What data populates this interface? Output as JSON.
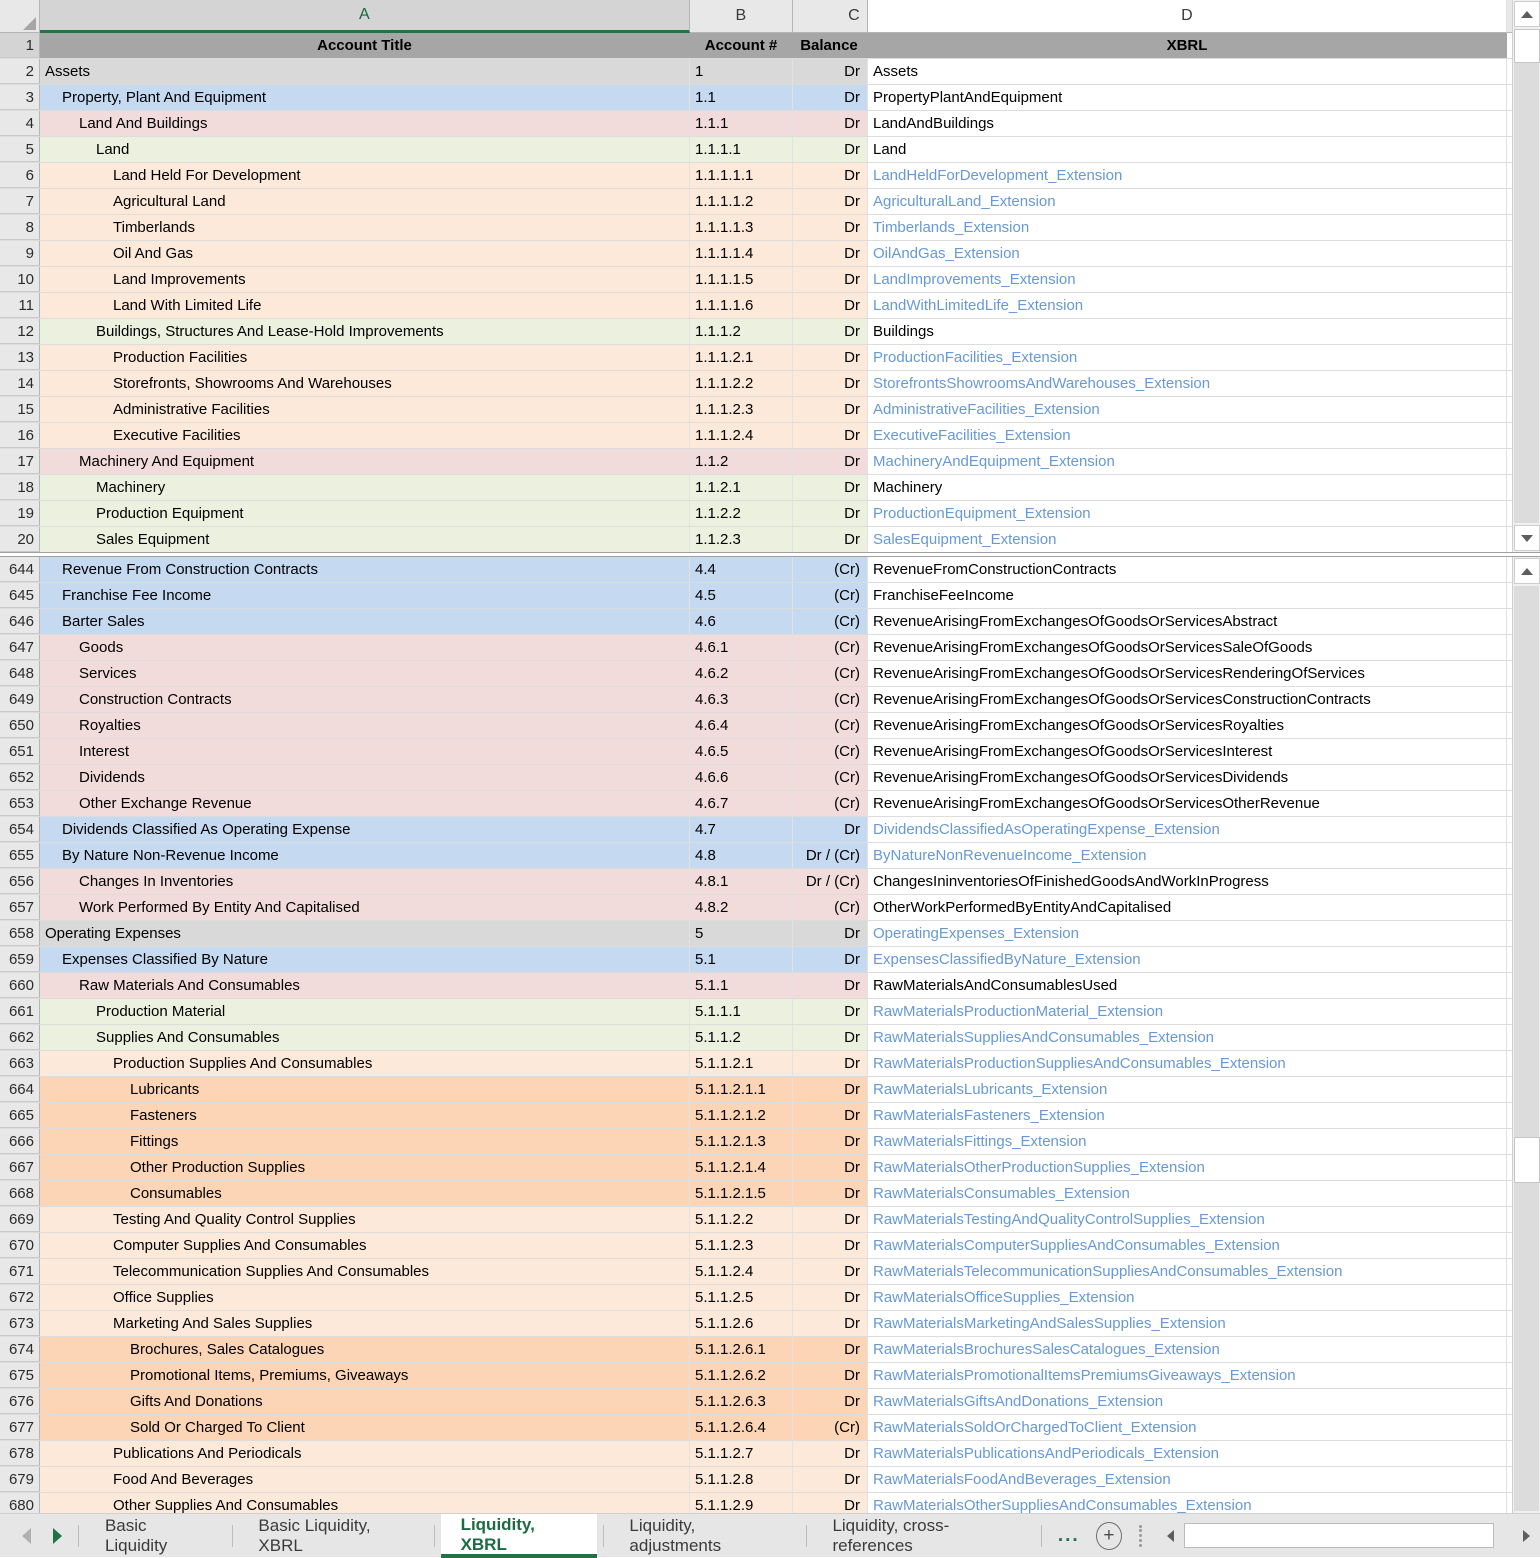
{
  "columns": {
    "headers": [
      {
        "letter": "A",
        "selected": true
      },
      {
        "letter": "B",
        "selected": false
      },
      {
        "letter": "C",
        "selected": false
      },
      {
        "letter": "D",
        "selected": false
      }
    ]
  },
  "header_row": {
    "num": "1",
    "a": "Account Title",
    "b": "Account #",
    "c": "Balance",
    "d": "XBRL"
  },
  "pane_top": [
    {
      "num": "2",
      "title": "Assets",
      "indent": 0,
      "acct": "1",
      "bal": "Dr",
      "xbrl": "Assets",
      "ext": false,
      "fill": "f-grey"
    },
    {
      "num": "3",
      "title": "Property, Plant And Equipment",
      "indent": 1,
      "acct": "1.1",
      "bal": "Dr",
      "xbrl": "PropertyPlantAndEquipment",
      "ext": false,
      "fill": "f-blue"
    },
    {
      "num": "4",
      "title": "Land And Buildings",
      "indent": 2,
      "acct": "1.1.1",
      "bal": "Dr",
      "xbrl": "LandAndBuildings",
      "ext": false,
      "fill": "f-pink"
    },
    {
      "num": "5",
      "title": "Land",
      "indent": 3,
      "acct": "1.1.1.1",
      "bal": "Dr",
      "xbrl": "Land",
      "ext": false,
      "fill": "f-green"
    },
    {
      "num": "6",
      "title": "Land Held For Development",
      "indent": 4,
      "acct": "1.1.1.1.1",
      "bal": "Dr",
      "xbrl": "LandHeldForDevelopment_Extension",
      "ext": true,
      "fill": "f-orange"
    },
    {
      "num": "7",
      "title": "Agricultural Land",
      "indent": 4,
      "acct": "1.1.1.1.2",
      "bal": "Dr",
      "xbrl": "AgriculturalLand_Extension",
      "ext": true,
      "fill": "f-orange"
    },
    {
      "num": "8",
      "title": "Timberlands",
      "indent": 4,
      "acct": "1.1.1.1.3",
      "bal": "Dr",
      "xbrl": "Timberlands_Extension",
      "ext": true,
      "fill": "f-orange"
    },
    {
      "num": "9",
      "title": "Oil And Gas",
      "indent": 4,
      "acct": "1.1.1.1.4",
      "bal": "Dr",
      "xbrl": "OilAndGas_Extension",
      "ext": true,
      "fill": "f-orange"
    },
    {
      "num": "10",
      "title": "Land Improvements",
      "indent": 4,
      "acct": "1.1.1.1.5",
      "bal": "Dr",
      "xbrl": "LandImprovements_Extension",
      "ext": true,
      "fill": "f-orange"
    },
    {
      "num": "11",
      "title": "Land With Limited Life",
      "indent": 4,
      "acct": "1.1.1.1.6",
      "bal": "Dr",
      "xbrl": "LandWithLimitedLife_Extension",
      "ext": true,
      "fill": "f-orange"
    },
    {
      "num": "12",
      "title": "Buildings, Structures And Lease-Hold Improvements",
      "indent": 3,
      "acct": "1.1.1.2",
      "bal": "Dr",
      "xbrl": "Buildings",
      "ext": false,
      "fill": "f-green"
    },
    {
      "num": "13",
      "title": "Production Facilities",
      "indent": 4,
      "acct": "1.1.1.2.1",
      "bal": "Dr",
      "xbrl": "ProductionFacilities_Extension",
      "ext": true,
      "fill": "f-orange"
    },
    {
      "num": "14",
      "title": "Storefronts, Showrooms And Warehouses",
      "indent": 4,
      "acct": "1.1.1.2.2",
      "bal": "Dr",
      "xbrl": "StorefrontsShowroomsAndWarehouses_Extension",
      "ext": true,
      "fill": "f-orange"
    },
    {
      "num": "15",
      "title": "Administrative Facilities",
      "indent": 4,
      "acct": "1.1.1.2.3",
      "bal": "Dr",
      "xbrl": "AdministrativeFacilities_Extension",
      "ext": true,
      "fill": "f-orange"
    },
    {
      "num": "16",
      "title": "Executive Facilities",
      "indent": 4,
      "acct": "1.1.1.2.4",
      "bal": "Dr",
      "xbrl": "ExecutiveFacilities_Extension",
      "ext": true,
      "fill": "f-orange"
    },
    {
      "num": "17",
      "title": "Machinery And Equipment",
      "indent": 2,
      "acct": "1.1.2",
      "bal": "Dr",
      "xbrl": "MachineryAndEquipment_Extension",
      "ext": true,
      "fill": "f-pink"
    },
    {
      "num": "18",
      "title": "Machinery",
      "indent": 3,
      "acct": "1.1.2.1",
      "bal": "Dr",
      "xbrl": "Machinery",
      "ext": false,
      "fill": "f-green"
    },
    {
      "num": "19",
      "title": "Production Equipment",
      "indent": 3,
      "acct": "1.1.2.2",
      "bal": "Dr",
      "xbrl": "ProductionEquipment_Extension",
      "ext": true,
      "fill": "f-green"
    },
    {
      "num": "20",
      "title": "Sales Equipment",
      "indent": 3,
      "acct": "1.1.2.3",
      "bal": "Dr",
      "xbrl": "SalesEquipment_Extension",
      "ext": true,
      "fill": "f-green"
    }
  ],
  "pane_bottom": [
    {
      "num": "644",
      "title": "Revenue From Construction Contracts",
      "indent": 1,
      "acct": "4.4",
      "bal": "(Cr)",
      "xbrl": "RevenueFromConstructionContracts",
      "ext": false,
      "fill": "f-blue"
    },
    {
      "num": "645",
      "title": "Franchise Fee Income",
      "indent": 1,
      "acct": "4.5",
      "bal": "(Cr)",
      "xbrl": "FranchiseFeeIncome",
      "ext": false,
      "fill": "f-blue"
    },
    {
      "num": "646",
      "title": "Barter Sales",
      "indent": 1,
      "acct": "4.6",
      "bal": "(Cr)",
      "xbrl": "RevenueArisingFromExchangesOfGoodsOrServicesAbstract",
      "ext": false,
      "fill": "f-blue"
    },
    {
      "num": "647",
      "title": "Goods",
      "indent": 2,
      "acct": "4.6.1",
      "bal": "(Cr)",
      "xbrl": "RevenueArisingFromExchangesOfGoodsOrServicesSaleOfGoods",
      "ext": false,
      "fill": "f-pink"
    },
    {
      "num": "648",
      "title": "Services",
      "indent": 2,
      "acct": "4.6.2",
      "bal": "(Cr)",
      "xbrl": "RevenueArisingFromExchangesOfGoodsOrServicesRenderingOfServices",
      "ext": false,
      "fill": "f-pink"
    },
    {
      "num": "649",
      "title": "Construction Contracts",
      "indent": 2,
      "acct": "4.6.3",
      "bal": "(Cr)",
      "xbrl": "RevenueArisingFromExchangesOfGoodsOrServicesConstructionContracts",
      "ext": false,
      "fill": "f-pink"
    },
    {
      "num": "650",
      "title": "Royalties",
      "indent": 2,
      "acct": "4.6.4",
      "bal": "(Cr)",
      "xbrl": "RevenueArisingFromExchangesOfGoodsOrServicesRoyalties",
      "ext": false,
      "fill": "f-pink"
    },
    {
      "num": "651",
      "title": "Interest",
      "indent": 2,
      "acct": "4.6.5",
      "bal": "(Cr)",
      "xbrl": "RevenueArisingFromExchangesOfGoodsOrServicesInterest",
      "ext": false,
      "fill": "f-pink"
    },
    {
      "num": "652",
      "title": "Dividends",
      "indent": 2,
      "acct": "4.6.6",
      "bal": "(Cr)",
      "xbrl": "RevenueArisingFromExchangesOfGoodsOrServicesDividends",
      "ext": false,
      "fill": "f-pink"
    },
    {
      "num": "653",
      "title": "Other Exchange Revenue",
      "indent": 2,
      "acct": "4.6.7",
      "bal": "(Cr)",
      "xbrl": "RevenueArisingFromExchangesOfGoodsOrServicesOtherRevenue",
      "ext": false,
      "fill": "f-pink"
    },
    {
      "num": "654",
      "title": "Dividends Classified As Operating Expense",
      "indent": 1,
      "acct": "4.7",
      "bal": "Dr",
      "xbrl": "DividendsClassifiedAsOperatingExpense_Extension",
      "ext": true,
      "fill": "f-blue"
    },
    {
      "num": "655",
      "title": "By Nature Non-Revenue Income",
      "indent": 1,
      "acct": "4.8",
      "bal": "Dr / (Cr)",
      "xbrl": "ByNatureNonRevenueIncome_Extension",
      "ext": true,
      "fill": "f-blue"
    },
    {
      "num": "656",
      "title": "Changes In Inventories",
      "indent": 2,
      "acct": "4.8.1",
      "bal": "Dr / (Cr)",
      "xbrl": "ChangesIninventoriesOfFinishedGoodsAndWorkInProgress",
      "ext": false,
      "fill": "f-pink"
    },
    {
      "num": "657",
      "title": "Work Performed By Entity And Capitalised",
      "indent": 2,
      "acct": "4.8.2",
      "bal": "(Cr)",
      "xbrl": "OtherWorkPerformedByEntityAndCapitalised",
      "ext": false,
      "fill": "f-pink"
    },
    {
      "num": "658",
      "title": "Operating Expenses",
      "indent": 0,
      "acct": "5",
      "bal": "Dr",
      "xbrl": "OperatingExpenses_Extension",
      "ext": true,
      "fill": "f-grey"
    },
    {
      "num": "659",
      "title": "Expenses Classified By Nature",
      "indent": 1,
      "acct": "5.1",
      "bal": "Dr",
      "xbrl": "ExpensesClassifiedByNature_Extension",
      "ext": true,
      "fill": "f-blue"
    },
    {
      "num": "660",
      "title": "Raw Materials And Consumables",
      "indent": 2,
      "acct": "5.1.1",
      "bal": "Dr",
      "xbrl": "RawMaterialsAndConsumablesUsed",
      "ext": false,
      "fill": "f-pink"
    },
    {
      "num": "661",
      "title": "Production Material",
      "indent": 3,
      "acct": "5.1.1.1",
      "bal": "Dr",
      "xbrl": "RawMaterialsProductionMaterial_Extension",
      "ext": true,
      "fill": "f-green"
    },
    {
      "num": "662",
      "title": "Supplies And Consumables",
      "indent": 3,
      "acct": "5.1.1.2",
      "bal": "Dr",
      "xbrl": "RawMaterialsSuppliesAndConsumables_Extension",
      "ext": true,
      "fill": "f-green"
    },
    {
      "num": "663",
      "title": "Production Supplies And Consumables",
      "indent": 4,
      "acct": "5.1.1.2.1",
      "bal": "Dr",
      "xbrl": "RawMaterialsProductionSuppliesAndConsumables_Extension",
      "ext": true,
      "fill": "f-orange"
    },
    {
      "num": "664",
      "title": "Lubricants",
      "indent": 5,
      "acct": "5.1.1.2.1.1",
      "bal": "Dr",
      "xbrl": "RawMaterialsLubricants_Extension",
      "ext": true,
      "fill": "f-orange2"
    },
    {
      "num": "665",
      "title": "Fasteners",
      "indent": 5,
      "acct": "5.1.1.2.1.2",
      "bal": "Dr",
      "xbrl": "RawMaterialsFasteners_Extension",
      "ext": true,
      "fill": "f-orange2"
    },
    {
      "num": "666",
      "title": "Fittings",
      "indent": 5,
      "acct": "5.1.1.2.1.3",
      "bal": "Dr",
      "xbrl": "RawMaterialsFittings_Extension",
      "ext": true,
      "fill": "f-orange2"
    },
    {
      "num": "667",
      "title": "Other Production Supplies",
      "indent": 5,
      "acct": "5.1.1.2.1.4",
      "bal": "Dr",
      "xbrl": "RawMaterialsOtherProductionSupplies_Extension",
      "ext": true,
      "fill": "f-orange2"
    },
    {
      "num": "668",
      "title": "Consumables",
      "indent": 5,
      "acct": "5.1.1.2.1.5",
      "bal": "Dr",
      "xbrl": "RawMaterialsConsumables_Extension",
      "ext": true,
      "fill": "f-orange2"
    },
    {
      "num": "669",
      "title": "Testing And Quality Control Supplies",
      "indent": 4,
      "acct": "5.1.1.2.2",
      "bal": "Dr",
      "xbrl": "RawMaterialsTestingAndQualityControlSupplies_Extension",
      "ext": true,
      "fill": "f-orange"
    },
    {
      "num": "670",
      "title": "Computer Supplies And Consumables",
      "indent": 4,
      "acct": "5.1.1.2.3",
      "bal": "Dr",
      "xbrl": "RawMaterialsComputerSuppliesAndConsumables_Extension",
      "ext": true,
      "fill": "f-orange"
    },
    {
      "num": "671",
      "title": "Telecommunication Supplies And Consumables",
      "indent": 4,
      "acct": "5.1.1.2.4",
      "bal": "Dr",
      "xbrl": "RawMaterialsTelecommunicationSuppliesAndConsumables_Extension",
      "ext": true,
      "fill": "f-orange"
    },
    {
      "num": "672",
      "title": "Office Supplies",
      "indent": 4,
      "acct": "5.1.1.2.5",
      "bal": "Dr",
      "xbrl": "RawMaterialsOfficeSupplies_Extension",
      "ext": true,
      "fill": "f-orange"
    },
    {
      "num": "673",
      "title": "Marketing And Sales Supplies",
      "indent": 4,
      "acct": "5.1.1.2.6",
      "bal": "Dr",
      "xbrl": "RawMaterialsMarketingAndSalesSupplies_Extension",
      "ext": true,
      "fill": "f-orange"
    },
    {
      "num": "674",
      "title": "Brochures, Sales Catalogues",
      "indent": 5,
      "acct": "5.1.1.2.6.1",
      "bal": "Dr",
      "xbrl": "RawMaterialsBrochuresSalesCatalogues_Extension",
      "ext": true,
      "fill": "f-orange2"
    },
    {
      "num": "675",
      "title": "Promotional Items, Premiums, Giveaways",
      "indent": 5,
      "acct": "5.1.1.2.6.2",
      "bal": "Dr",
      "xbrl": "RawMaterialsPromotionalItemsPremiumsGiveaways_Extension",
      "ext": true,
      "fill": "f-orange2"
    },
    {
      "num": "676",
      "title": "Gifts And Donations",
      "indent": 5,
      "acct": "5.1.1.2.6.3",
      "bal": "Dr",
      "xbrl": "RawMaterialsGiftsAndDonations_Extension",
      "ext": true,
      "fill": "f-orange2"
    },
    {
      "num": "677",
      "title": "Sold Or Charged To Client",
      "indent": 5,
      "acct": "5.1.1.2.6.4",
      "bal": "(Cr)",
      "xbrl": "RawMaterialsSoldOrChargedToClient_Extension",
      "ext": true,
      "fill": "f-orange2"
    },
    {
      "num": "678",
      "title": "Publications And Periodicals",
      "indent": 4,
      "acct": "5.1.1.2.7",
      "bal": "Dr",
      "xbrl": "RawMaterialsPublicationsAndPeriodicals_Extension",
      "ext": true,
      "fill": "f-orange"
    },
    {
      "num": "679",
      "title": "Food And Beverages",
      "indent": 4,
      "acct": "5.1.1.2.8",
      "bal": "Dr",
      "xbrl": "RawMaterialsFoodAndBeverages_Extension",
      "ext": true,
      "fill": "f-orange"
    },
    {
      "num": "680",
      "title": "Other Supplies And Consumables",
      "indent": 4,
      "acct": "5.1.1.2.9",
      "bal": "Dr",
      "xbrl": "RawMaterialsOtherSuppliesAndConsumables_Extension",
      "ext": true,
      "fill": "f-orange"
    }
  ],
  "sheet_tabs": {
    "tabs": [
      {
        "label": "Basic Liquidity",
        "active": false
      },
      {
        "label": "Basic Liquidity, XBRL",
        "active": false
      },
      {
        "label": "Liquidity, XBRL",
        "active": true
      },
      {
        "label": "Liquidity, adjustments",
        "active": false
      },
      {
        "label": "Liquidity, cross-references",
        "active": false
      }
    ],
    "overflow_label": "...",
    "add_sheet_label": "+"
  },
  "colors": {
    "accent_green": "#217346",
    "header_fill": "#a6a6a6",
    "extension_link": "#6699d6"
  }
}
